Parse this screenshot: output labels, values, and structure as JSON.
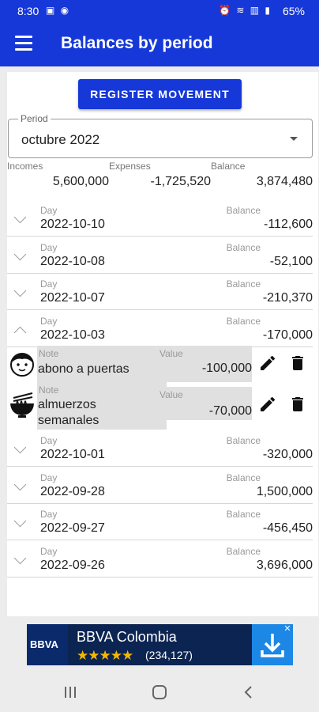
{
  "status": {
    "time": "8:30",
    "battery": "65%"
  },
  "appbar": {
    "title": "Balances by period"
  },
  "register_button": "REGISTER MOVEMENT",
  "period": {
    "label": "Period",
    "value": "octubre 2022"
  },
  "summary": {
    "incomes_label": "Incomes",
    "incomes": "5,600,000",
    "expenses_label": "Expenses",
    "expenses": "-1,725,520",
    "balance_label": "Balance",
    "balance": "3,874,480"
  },
  "day_label": "Day",
  "balance_label": "Balance",
  "days": [
    {
      "date": "2022-10-10",
      "balance": "-112,600"
    },
    {
      "date": "2022-10-08",
      "balance": "-52,100"
    },
    {
      "date": "2022-10-07",
      "balance": "-210,370"
    },
    {
      "date": "2022-10-03",
      "balance": "-170,000"
    },
    {
      "date": "2022-10-01",
      "balance": "-320,000"
    },
    {
      "date": "2022-09-28",
      "balance": "1,500,000"
    },
    {
      "date": "2022-09-27",
      "balance": "-456,450"
    },
    {
      "date": "2022-09-26",
      "balance": "3,696,000"
    }
  ],
  "movement_labels": {
    "note": "Note",
    "value": "Value"
  },
  "movements": [
    {
      "icon": "face-icon",
      "note": "abono a puertas",
      "value": "-100,000"
    },
    {
      "icon": "noodle-bowl-icon",
      "note_line1": "almuerzos",
      "note_line2": "semanales",
      "value": "-70,000"
    }
  ],
  "ad": {
    "logo": "BBVA",
    "title": "BBVA Colombia",
    "stars": "★★★★★",
    "rating": "(234,127)",
    "star_color": "#f5b800"
  },
  "colors": {
    "primary": "#1638d8"
  }
}
